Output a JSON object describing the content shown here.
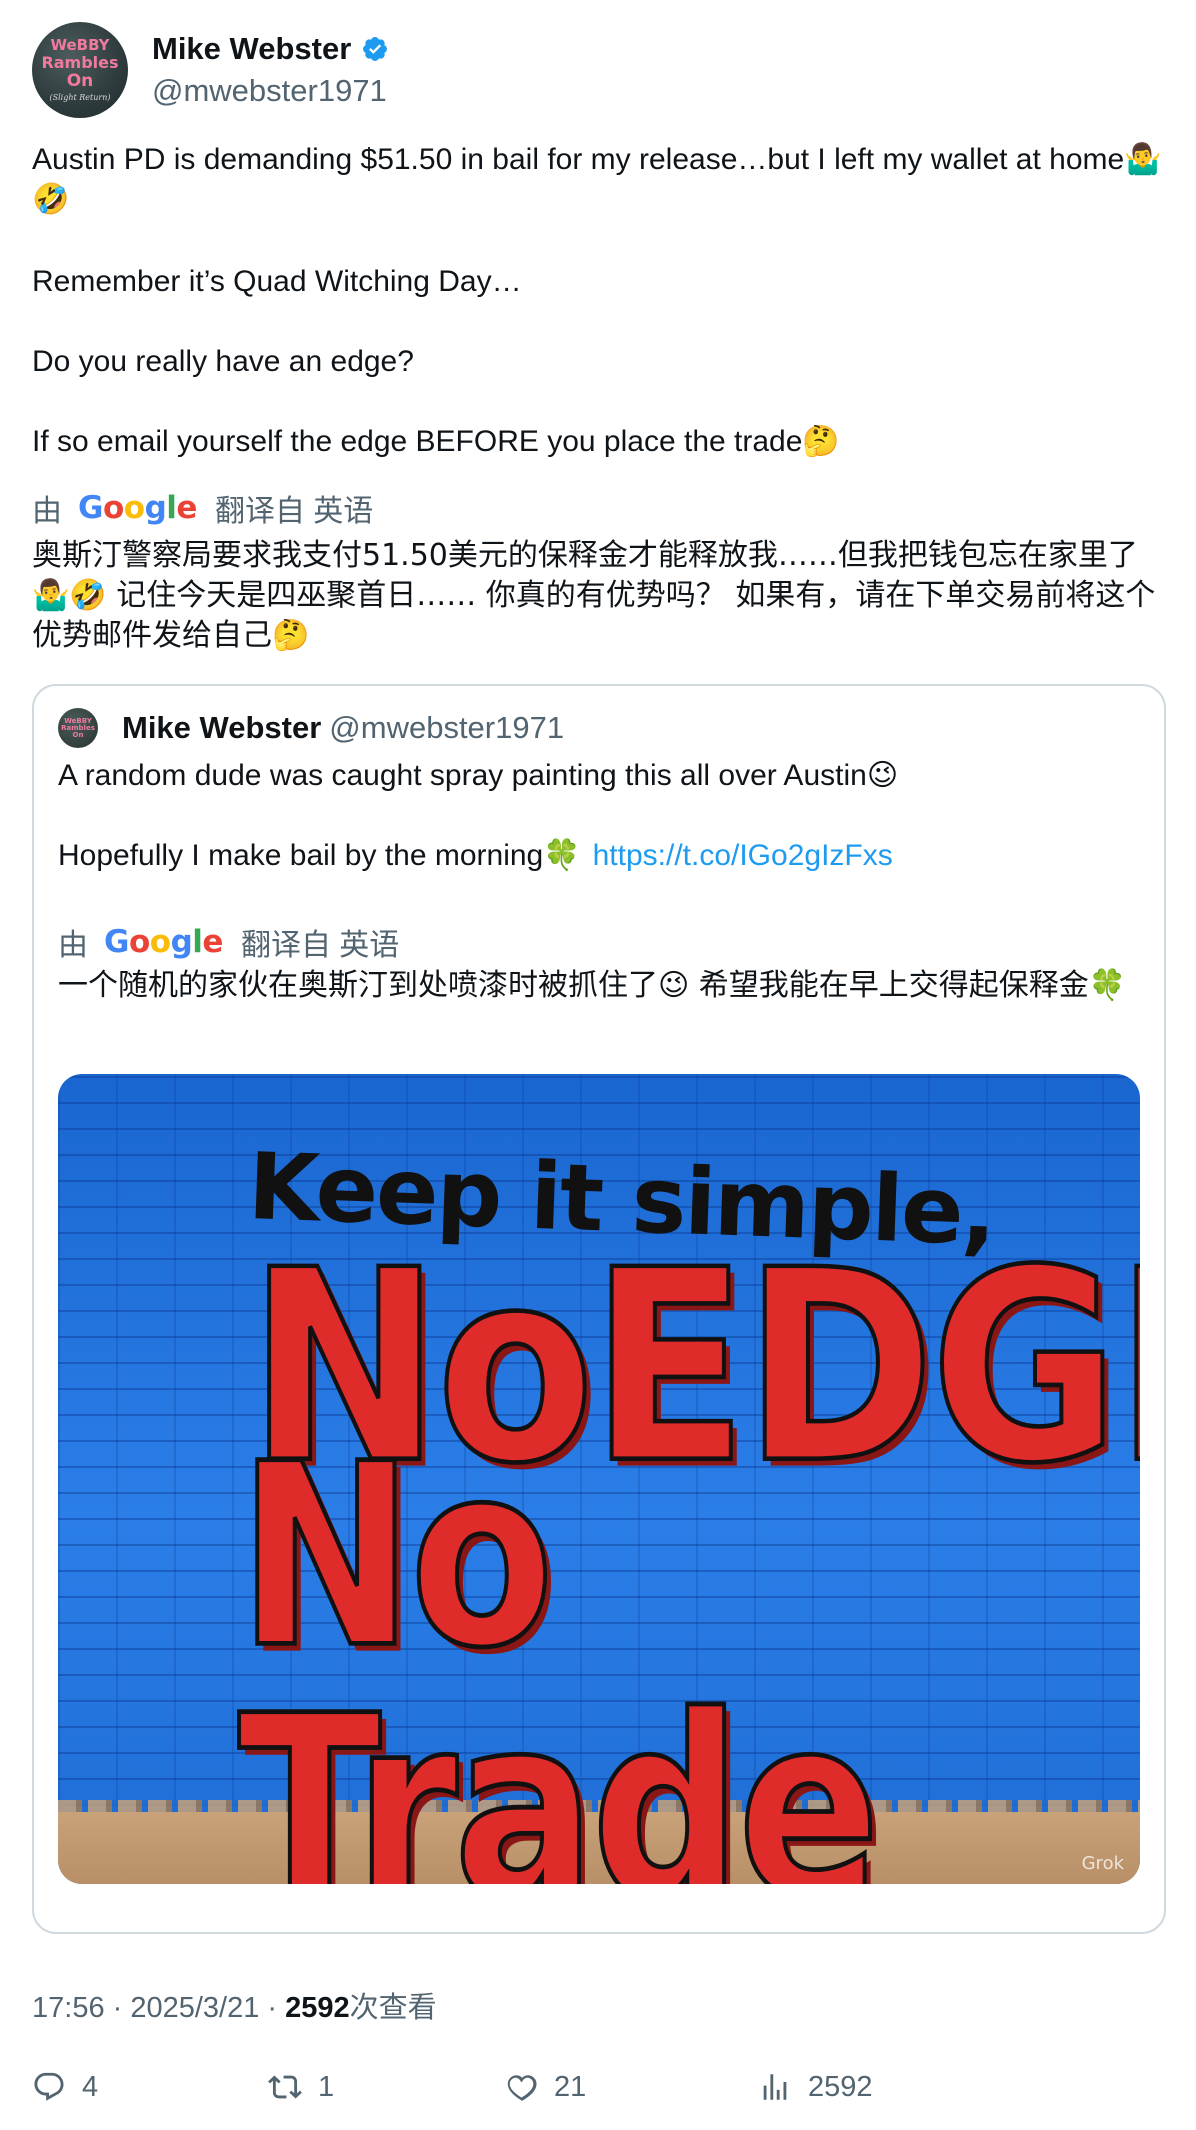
{
  "author": {
    "name": "Mike Webster",
    "handle": "@mwebster1971",
    "avatar_text": [
      "WeBBY",
      "Rambles",
      "On",
      "(Slight Return)"
    ]
  },
  "tweet": {
    "lines": [
      "Austin PD is demanding $51.50 in bail for my release…but I left my wallet at home🤷‍♂️🤣",
      "Remember it’s Quad Witching Day…",
      "Do you really have an edge?",
      "If so email yourself the edge BEFORE you place the trade🤔"
    ],
    "translate_prefix": "由",
    "translate_suffix": "翻译自 英语",
    "translation": "奥斯汀警察局要求我支付51.50美元的保释金才能释放我……但我把钱包忘在家里了🤷‍♂️🤣 记住今天是四巫聚首日…… 你真的有优势吗？ 如果有，请在下单交易前将这个优势邮件发给自己🤔"
  },
  "quoted": {
    "name": "Mike Webster",
    "handle": "@mwebster1971",
    "line1": "A random dude was caught spray painting this all over Austin😉",
    "line2": "Hopefully I make bail by the morning🍀",
    "link": "https://t.co/IGo2gIzFxs",
    "translate_prefix": "由",
    "translate_suffix": "翻译自 英语",
    "translation": "一个随机的家伙在奥斯汀到处喷漆时被抓住了😉 希望我能在早上交得起保释金🍀",
    "image": {
      "line1": "Keep it simple,",
      "line2": "NoEDGE,",
      "line3": "No Trade !!!",
      "watermark": "Grok"
    }
  },
  "meta": {
    "time": "17:56 · 2025/3/21 · ",
    "views": "2592",
    "views_label": "次查看"
  },
  "actions": {
    "replies": "4",
    "retweets": "1",
    "likes": "21",
    "views": "2592"
  },
  "icons": {
    "verified": "verified-badge-icon",
    "reply": "reply-icon",
    "retweet": "retweet-icon",
    "like": "heart-icon",
    "views": "views-icon"
  },
  "colors": {
    "link": "#1d9bf0",
    "secondary": "#536471",
    "verified": "#1d9bf0"
  }
}
